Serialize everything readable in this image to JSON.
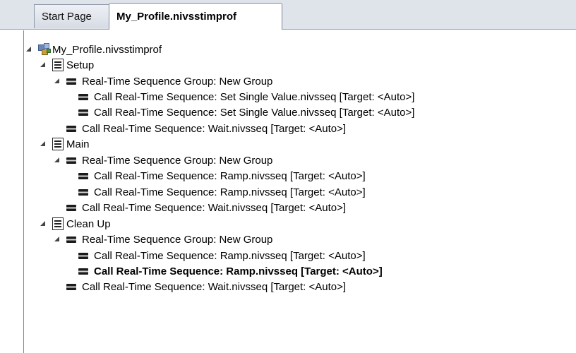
{
  "tabs": [
    {
      "label": "Start Page"
    },
    {
      "label": "My_Profile.nivsstimprof"
    }
  ],
  "tree": {
    "root": "My_Profile.nivsstimprof",
    "items": [
      {
        "label": "Setup"
      },
      {
        "label": "Real-Time Sequence Group: New Group"
      },
      {
        "label": "Call Real-Time Sequence: Set Single Value.nivsseq [Target: <Auto>]"
      },
      {
        "label": "Call Real-Time Sequence: Set Single Value.nivsseq [Target: <Auto>]"
      },
      {
        "label": "Call Real-Time Sequence: Wait.nivsseq [Target: <Auto>]"
      },
      {
        "label": "Main"
      },
      {
        "label": "Real-Time Sequence Group: New Group"
      },
      {
        "label": "Call Real-Time Sequence: Ramp.nivsseq [Target: <Auto>]"
      },
      {
        "label": "Call Real-Time Sequence: Ramp.nivsseq [Target: <Auto>]"
      },
      {
        "label": "Call Real-Time Sequence: Wait.nivsseq [Target: <Auto>]"
      },
      {
        "label": "Clean Up"
      },
      {
        "label": "Real-Time Sequence Group: New Group"
      },
      {
        "label": "Call Real-Time Sequence: Ramp.nivsseq [Target: <Auto>]"
      },
      {
        "label": "Call Real-Time Sequence: Ramp.nivsseq [Target: <Auto>]"
      },
      {
        "label": "Call Real-Time Sequence: Wait.nivsseq [Target: <Auto>]"
      }
    ]
  }
}
